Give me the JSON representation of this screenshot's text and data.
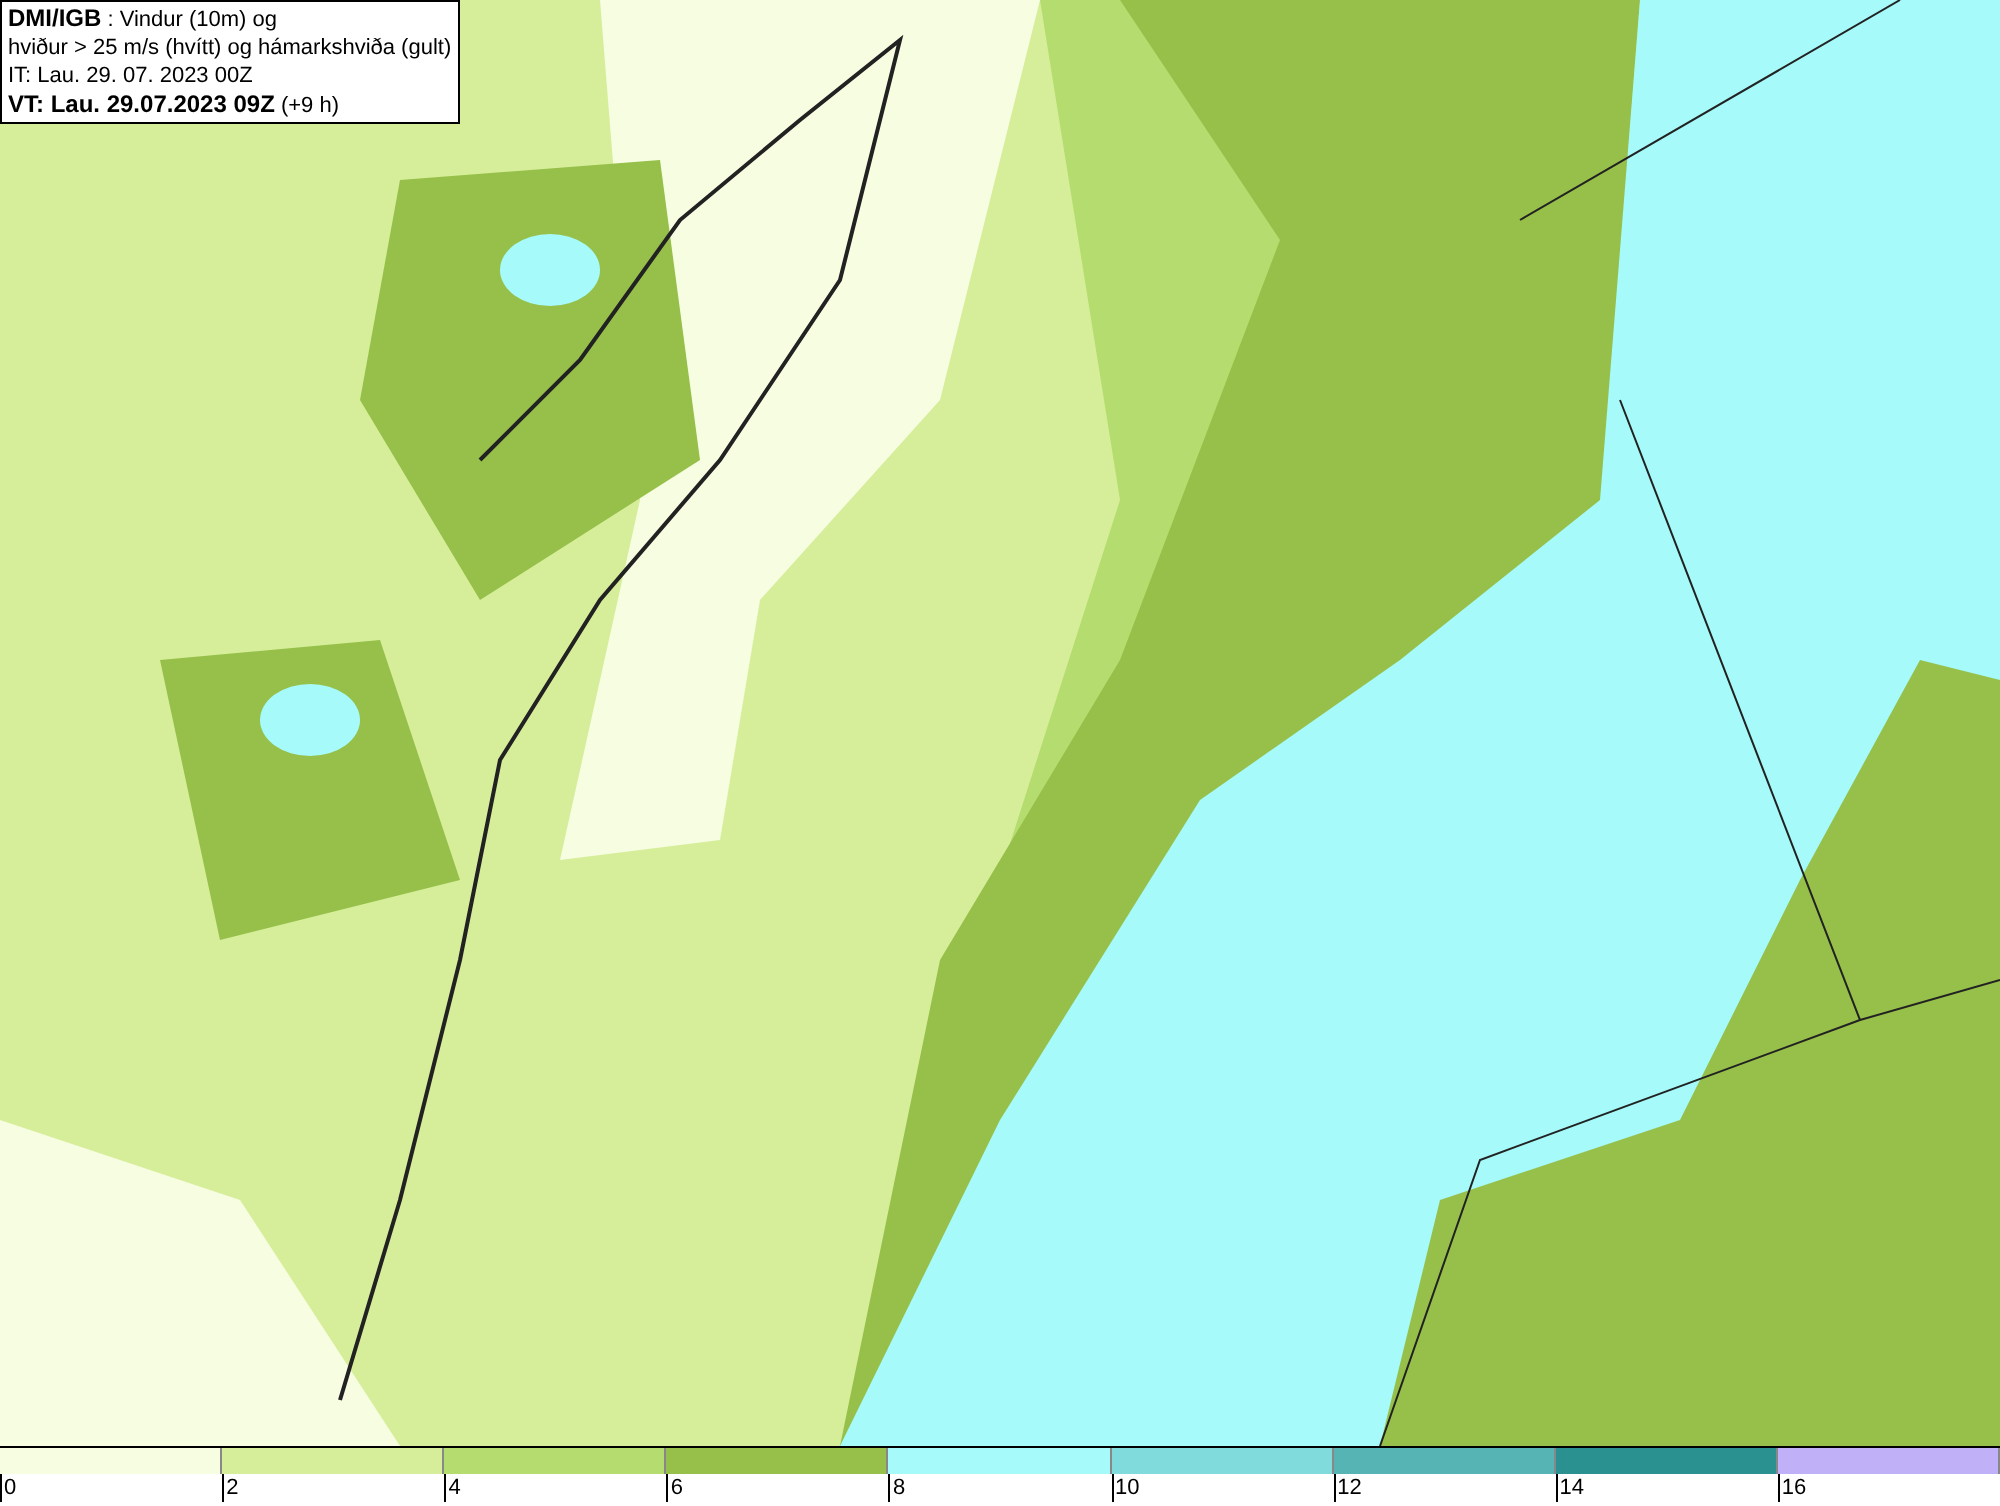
{
  "info_box": {
    "source": "DMI/IGB",
    "title_rest": " : Vindur (10m) og",
    "line_2": "hviður > 25 m/s (hvítt) og hámarkshviða (gult)",
    "line_3": "IT: Lau. 29. 07. 2023 00Z",
    "valid_bold": "VT: Lau. 29.07.2023 09Z",
    "valid_rest": " (+9 h)"
  },
  "legend": [
    {
      "label": "0",
      "color": "#f7fde0"
    },
    {
      "label": "2",
      "color": "#d6ee9a"
    },
    {
      "label": "4",
      "color": "#b5dc6e"
    },
    {
      "label": "6",
      "color": "#96c04a"
    },
    {
      "label": "8",
      "color": "#a6fafa"
    },
    {
      "label": "10",
      "color": "#80dcdc"
    },
    {
      "label": "12",
      "color": "#56b4b4"
    },
    {
      "label": "14",
      "color": "#2a9090"
    },
    {
      "label": "16",
      "color": "#c0b0f8"
    }
  ]
}
